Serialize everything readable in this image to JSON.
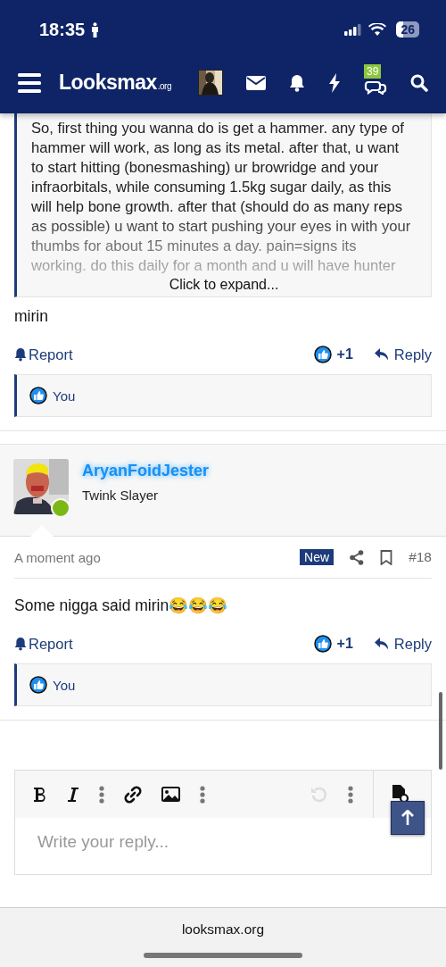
{
  "status_bar": {
    "time": "18:35",
    "battery": "26"
  },
  "nav": {
    "logo": "Looksmax",
    "logo_suffix": ".org",
    "chat_badge": "39"
  },
  "posts": [
    {
      "quote": {
        "text": "So, first thing you wanna do is get a hammer. any type of hammer will work, as long as its metal. after that, u want to start hitting (bonesmashing) ur browridge and your infraorbitals, while consuming 1.5kg sugar daily, as this will help bone growth. after that (should do as many reps as possible) u want to start pushing your eyes in with your thumbs for about 15 minutes a day. pain=signs its working. do this daily for a month and u will have hunter",
        "expand": "Click to expand..."
      },
      "message": "mirin",
      "report": "Report",
      "reaction_count": "+1",
      "reply": "Reply",
      "likes": "You"
    },
    {
      "author": {
        "name": "AryanFoidJester",
        "title": "Twink Slayer",
        "online": true
      },
      "time": "A moment ago",
      "badge": "New",
      "number": "#18",
      "message": "Some nigga said mirin😂😂😂",
      "report": "Report",
      "reaction_count": "+1",
      "reply": "Reply",
      "likes": "You"
    }
  ],
  "editor": {
    "placeholder": "Write your reply..."
  },
  "browser": {
    "url": "looksmax.org"
  }
}
